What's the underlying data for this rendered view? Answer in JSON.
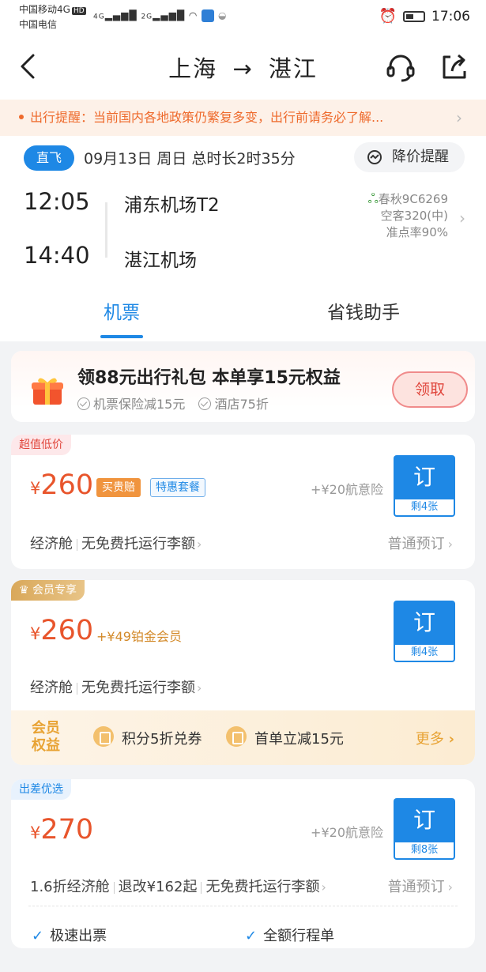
{
  "status_bar": {
    "carrier_1": "中国移动4G",
    "carrier_hd": "HD",
    "carrier_2": "中国电信",
    "signal_1": "4G",
    "signal_2": "2G",
    "time": "17:06"
  },
  "nav": {
    "title_from": "上海",
    "title_arrow": "→",
    "title_to": "湛江"
  },
  "notice": {
    "text": "出行提醒：当前国内各地政策仍繁复多变，出行前请务必了解..."
  },
  "flight": {
    "direct_label": "直飞",
    "date_info": "09月13日 周日 总时长2时35分",
    "price_alert_label": "降价提醒",
    "dep_time": "12:05",
    "dep_airport": "浦东机场T2",
    "arr_time": "14:40",
    "arr_airport": "湛江机场",
    "airline": "春秋9C6269",
    "aircraft": "空客320(中)",
    "on_time": "准点率90%"
  },
  "tabs": [
    {
      "label": "机票",
      "active": true
    },
    {
      "label": "省钱助手",
      "active": false
    }
  ],
  "promo": {
    "title": "领88元出行礼包 本单享15元权益",
    "benefit_1": "机票保险减15元",
    "benefit_2": "酒店75折",
    "claim_label": "领取"
  },
  "fares": [
    {
      "tag": "超值低价",
      "currency": "¥",
      "price": "260",
      "badge_1": "买贵赔",
      "badge_2": "特惠套餐",
      "insurance": "+¥20航意险",
      "book_label": "订",
      "seats_left": "剩4张",
      "cabin": "经济舱",
      "baggage": "无免费托运行李额",
      "ticket_type": "普通预订"
    },
    {
      "tag": "会员专享",
      "currency": "¥",
      "price": "260",
      "addon": "+¥49铂金会员",
      "book_label": "订",
      "seats_left": "剩4张",
      "cabin": "经济舱",
      "baggage": "无免费托运行李额",
      "member_label": "会员权益",
      "perk_1": "积分5折兑券",
      "perk_2": "首单立减15元",
      "more_label": "更多"
    },
    {
      "tag": "出差优选",
      "currency": "¥",
      "price": "270",
      "insurance": "+¥20航意险",
      "book_label": "订",
      "seats_left": "剩8张",
      "cabin": "1.6折经济舱",
      "refund": "退改¥162起",
      "baggage": "无免费托运行李额",
      "ticket_type": "普通预订",
      "feature_1": "极速出票",
      "feature_2": "全额行程单"
    }
  ],
  "colors": {
    "brand_blue": "#1e88e5",
    "price_orange": "#e8552c",
    "gold": "#e8a334"
  }
}
